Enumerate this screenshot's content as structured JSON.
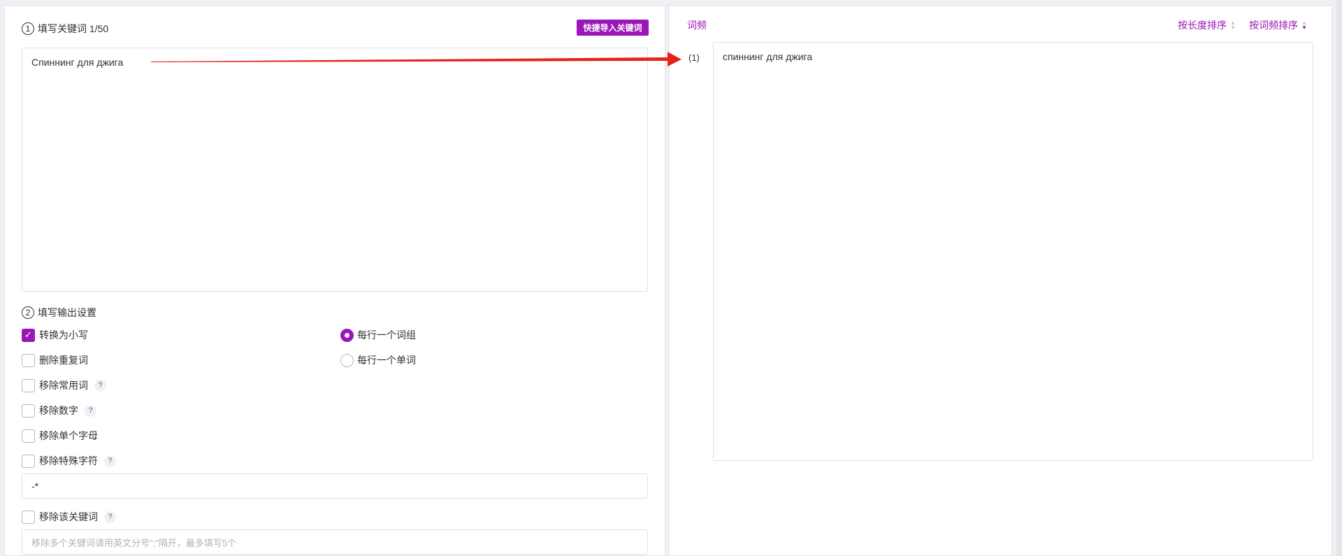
{
  "left": {
    "step1": {
      "num": "1",
      "title": "填写关键词 1/50"
    },
    "import_button": "快捷导入关键词",
    "keyword_text": "Спиннинг для джига",
    "step2": {
      "num": "2",
      "title": "填写输出设置"
    },
    "options": {
      "lowercase": {
        "label": "转换为小写",
        "checked": true
      },
      "remove_duplicates": {
        "label": "删除重复词",
        "checked": false
      },
      "remove_common": {
        "label": "移除常用词",
        "checked": false
      },
      "remove_numbers": {
        "label": "移除数字",
        "checked": false
      },
      "remove_single_letter": {
        "label": "移除单个字母",
        "checked": false
      },
      "remove_special": {
        "label": "移除特殊字符",
        "checked": false
      },
      "remove_keyword": {
        "label": "移除该关键词",
        "checked": false
      }
    },
    "radios": {
      "per_phrase": {
        "label": "每行一个词组",
        "checked": true
      },
      "per_word": {
        "label": "每行一个单词",
        "checked": false
      }
    },
    "help_mark": "?",
    "special_chars_value": "-*",
    "remove_keyword_placeholder": "移除多个关键词请用英文分号\";\"隔开，最多填写5个"
  },
  "right": {
    "freq_label": "词频",
    "sort_by_length": "按长度排序",
    "sort_by_frequency": "按词频排序",
    "results": [
      {
        "index": "(1)",
        "text": "спиннинг для джига"
      }
    ]
  },
  "colors": {
    "accent": "#9a16b8",
    "arrow": "#e8221b"
  }
}
